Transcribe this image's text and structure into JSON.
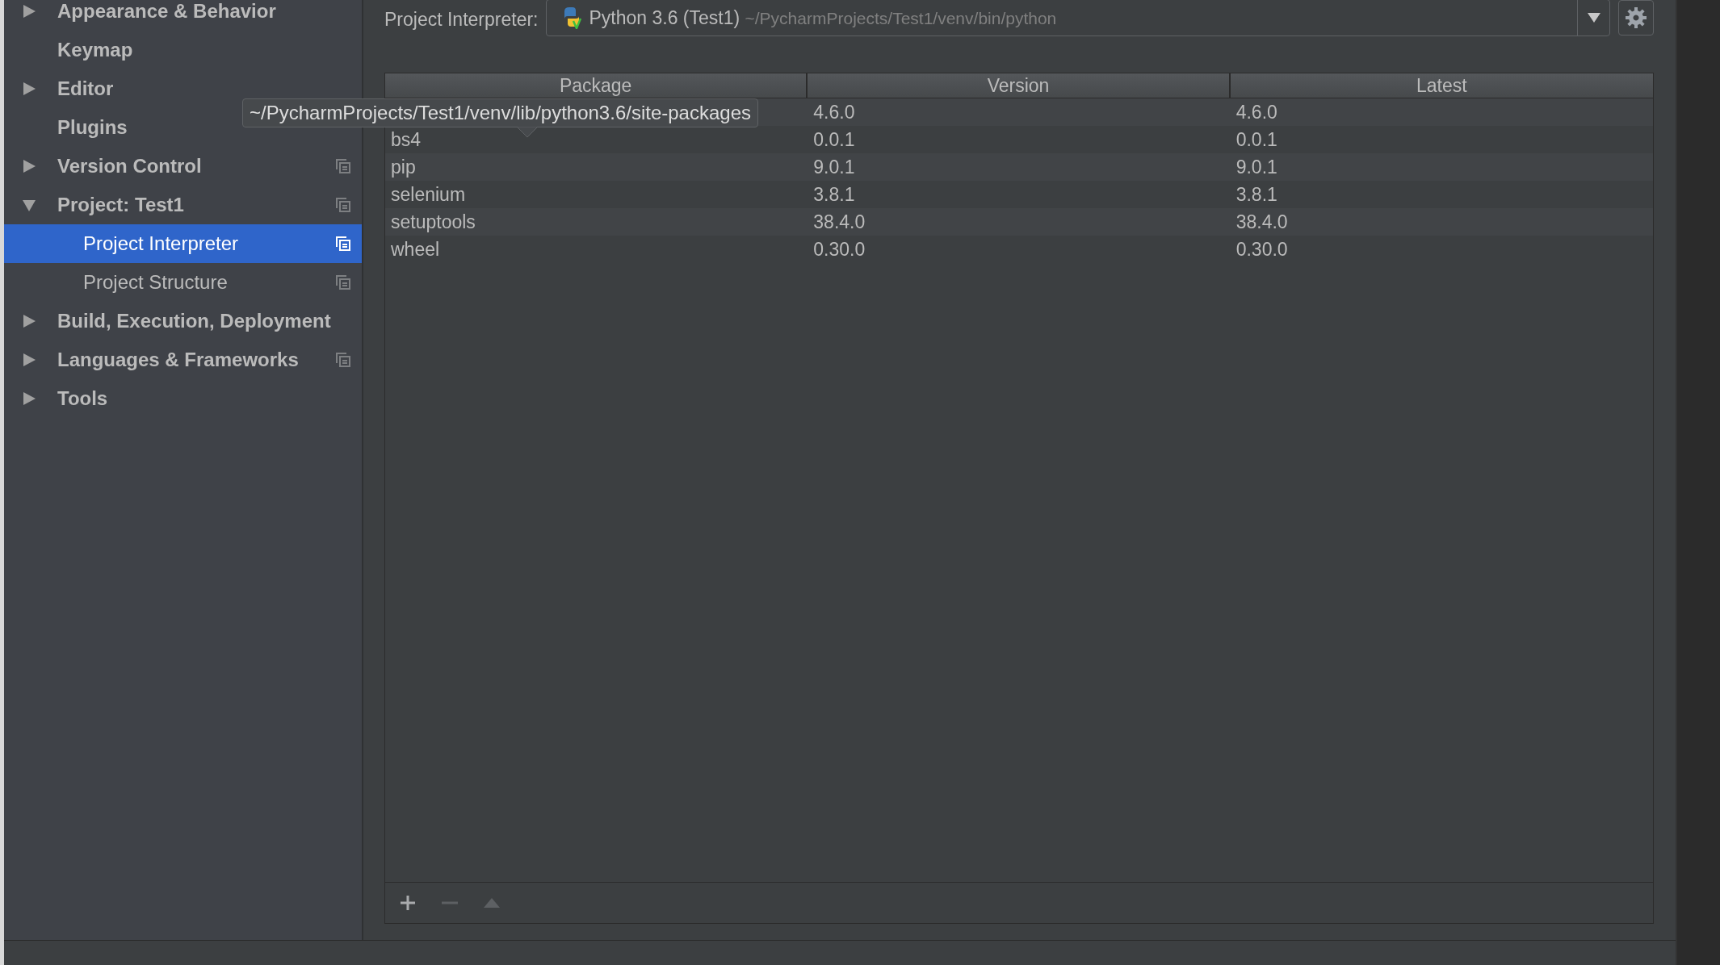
{
  "sidebar": {
    "items": [
      {
        "label": "Appearance & Behavior",
        "kind": "group",
        "expanded": false,
        "scoped": false,
        "selected": false
      },
      {
        "label": "Keymap",
        "kind": "leaf",
        "scoped": false,
        "selected": false
      },
      {
        "label": "Editor",
        "kind": "group",
        "expanded": false,
        "scoped": false,
        "selected": false
      },
      {
        "label": "Plugins",
        "kind": "leaf",
        "scoped": false,
        "selected": false
      },
      {
        "label": "Version Control",
        "kind": "group",
        "expanded": false,
        "scoped": true,
        "selected": false
      },
      {
        "label": "Project: Test1",
        "kind": "group",
        "expanded": true,
        "scoped": true,
        "selected": false,
        "children": [
          {
            "label": "Project Interpreter",
            "kind": "leaf",
            "scoped": true,
            "selected": true
          },
          {
            "label": "Project Structure",
            "kind": "leaf",
            "scoped": true,
            "selected": false
          }
        ]
      },
      {
        "label": "Build, Execution, Deployment",
        "kind": "group",
        "expanded": false,
        "scoped": false,
        "selected": false
      },
      {
        "label": "Languages & Frameworks",
        "kind": "group",
        "expanded": false,
        "scoped": true,
        "selected": false
      },
      {
        "label": "Tools",
        "kind": "group",
        "expanded": false,
        "scoped": false,
        "selected": false
      }
    ]
  },
  "interpreter": {
    "label": "Project Interpreter:",
    "name": "Python 3.6 (Test1)",
    "path": "~/PycharmProjects/Test1/venv/bin/python"
  },
  "table": {
    "columns": [
      "Package",
      "Version",
      "Latest"
    ],
    "rows": [
      {
        "version": "4.6.0",
        "latest": "4.6.0"
      },
      {
        "package": "bs4",
        "version": "0.0.1",
        "latest": "0.0.1"
      },
      {
        "package": "pip",
        "version": "9.0.1",
        "latest": "9.0.1"
      },
      {
        "package": "selenium",
        "version": "3.8.1",
        "latest": "3.8.1"
      },
      {
        "package": "setuptools",
        "version": "38.4.0",
        "latest": "38.4.0"
      },
      {
        "package": "wheel",
        "version": "0.30.0",
        "latest": "0.30.0"
      }
    ]
  },
  "toolbar": [
    {
      "kind": "add",
      "disabled": false
    },
    {
      "kind": "remove",
      "disabled": true
    },
    {
      "kind": "upgrade",
      "disabled": true
    }
  ],
  "tooltip": {
    "text": "~/PycharmProjects/Test1/venv/lib/python3.6/site-packages"
  }
}
